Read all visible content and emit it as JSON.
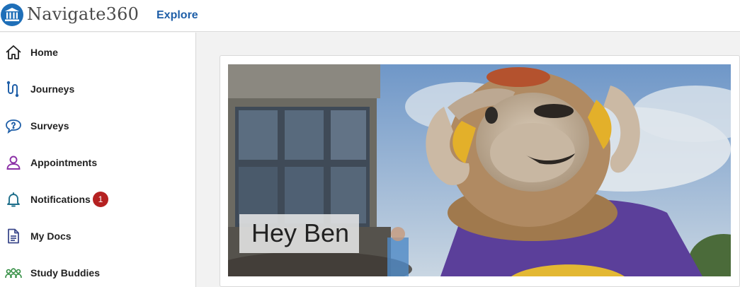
{
  "app": {
    "brand": "Navigate360",
    "brand_color": "#1f6fb8",
    "explore_label": "Explore"
  },
  "sidebar": {
    "items": [
      {
        "label": "Home",
        "icon": "home-icon"
      },
      {
        "label": "Journeys",
        "icon": "journeys-icon"
      },
      {
        "label": "Surveys",
        "icon": "surveys-icon"
      },
      {
        "label": "Appointments",
        "icon": "person-icon"
      },
      {
        "label": "Notifications",
        "icon": "bell-icon",
        "badge": "1"
      },
      {
        "label": "My Docs",
        "icon": "document-icon"
      },
      {
        "label": "Study Buddies",
        "icon": "study-buddies-icon"
      }
    ]
  },
  "hero": {
    "greeting": "Hey Ben",
    "image": "ram-mascot-photo"
  },
  "colors": {
    "accent": "#1f5fa8",
    "badge": "#b52121",
    "appointments_icon": "#8b2fa6",
    "study_buddies_icon": "#2e8b3e"
  }
}
